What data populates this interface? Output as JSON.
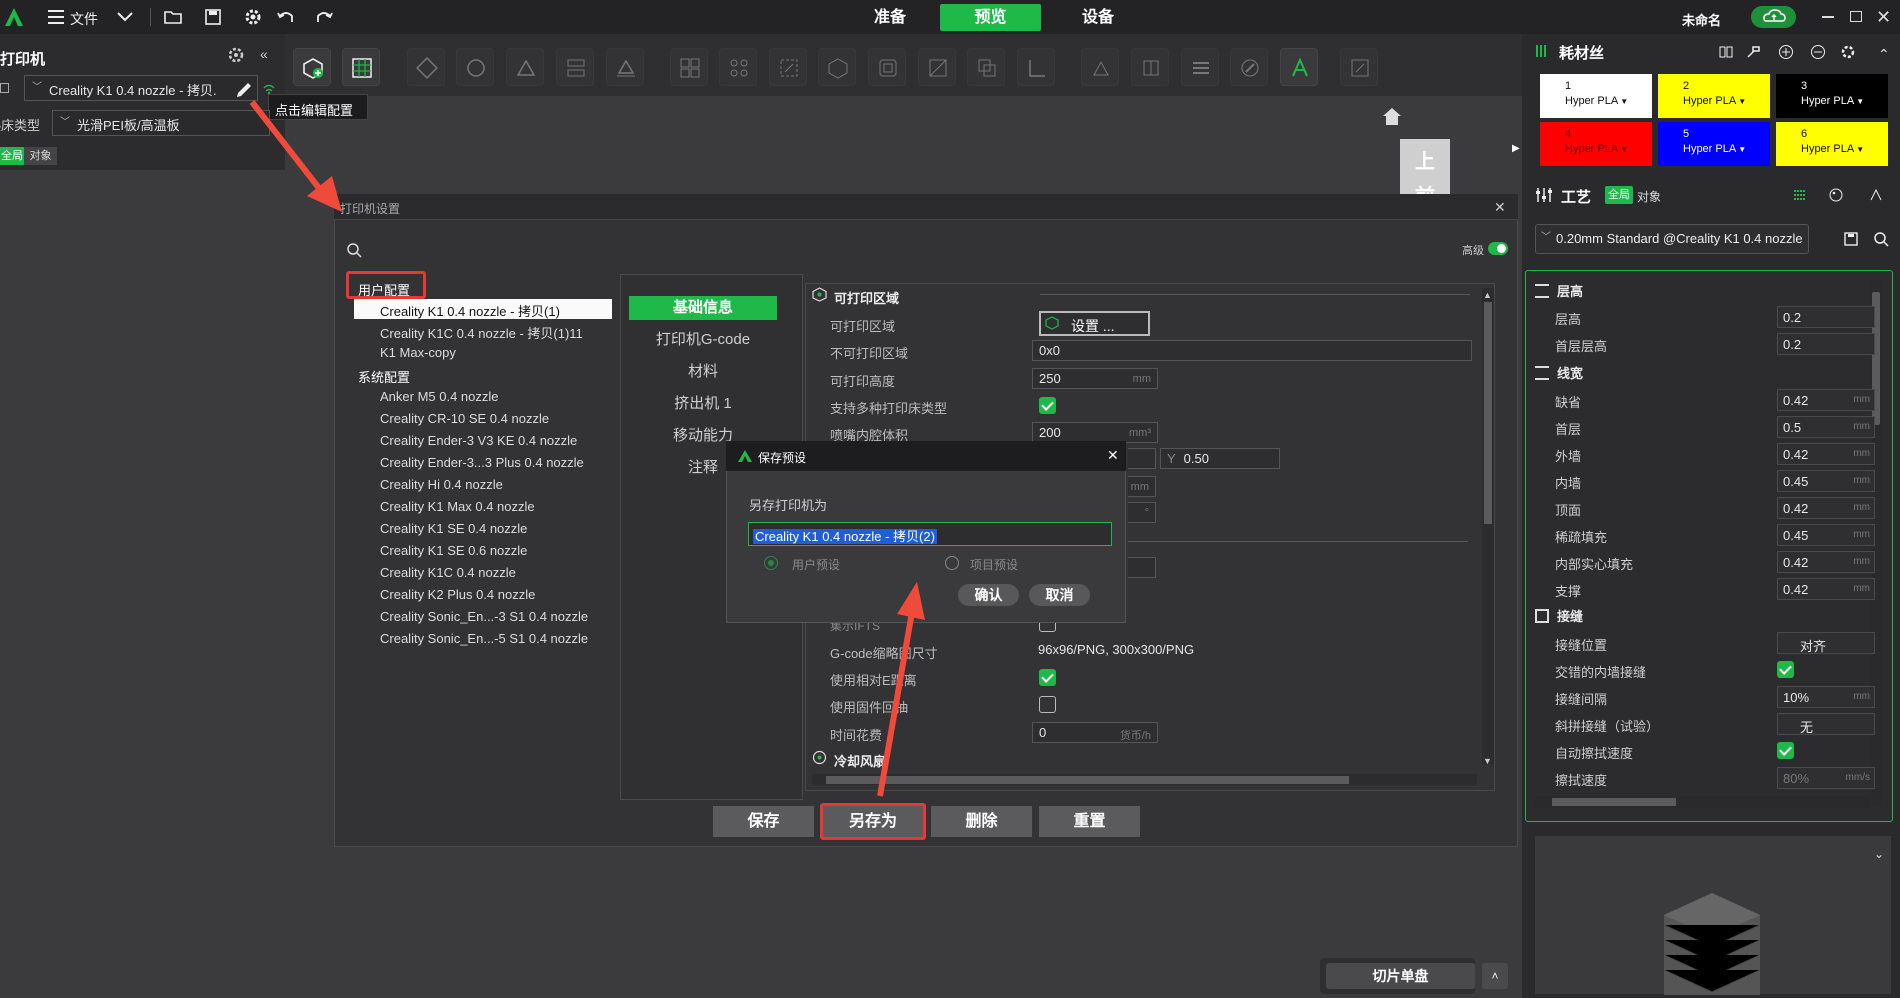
{
  "topbar": {
    "file_label": "文件",
    "tabs": [
      "准备",
      "预览",
      "设备"
    ],
    "active_tab": "预览",
    "project_name": "未命名",
    "accent": "#1fb94a"
  },
  "left": {
    "title": "打印机",
    "printer_name": "Creality K1 0.4 nozzle - 拷贝.",
    "bed_label": "热床类型",
    "bed_value": "光滑PEI板/高温板",
    "scope_global": "全局",
    "scope_object": "对象",
    "tooltip": "点击编辑配置"
  },
  "canvas": {
    "view_top": "上",
    "view_front": "前",
    "slice_button": "切片单盘"
  },
  "right": {
    "filament_title": "耗材丝",
    "filaments": [
      {
        "num": "1",
        "type": "Hyper PLA",
        "color": "#ffffff",
        "text": "#111111"
      },
      {
        "num": "2",
        "type": "Hyper PLA",
        "color": "#ffff00",
        "text": "#111111"
      },
      {
        "num": "3",
        "type": "Hyper PLA",
        "color": "#000000",
        "text": "#ffffff"
      },
      {
        "num": "4",
        "type": "Hyper PLA",
        "color": "#ff0000",
        "text": "#7a0000"
      },
      {
        "num": "5",
        "type": "Hyper PLA",
        "color": "#0000ff",
        "text": "#ffffff"
      },
      {
        "num": "6",
        "type": "Hyper PLA",
        "color": "#ffff00",
        "text": "#111111"
      }
    ],
    "process_title": "工艺",
    "process_global": "全局",
    "process_object": "对象",
    "process_preset": "0.20mm Standard @Creality K1 0.4 nozzle",
    "sec_layer": "层高",
    "layer_rows": [
      {
        "label": "层高",
        "value": "0.2"
      },
      {
        "label": "首层层高",
        "value": "0.2"
      }
    ],
    "sec_width": "线宽",
    "width_rows": [
      {
        "label": "缺省",
        "value": "0.42",
        "unit": "mm"
      },
      {
        "label": "首层",
        "value": "0.5",
        "unit": "mm"
      },
      {
        "label": "外墙",
        "value": "0.42",
        "unit": "mm"
      },
      {
        "label": "内墙",
        "value": "0.45",
        "unit": "mm"
      },
      {
        "label": "顶面",
        "value": "0.42",
        "unit": "mm"
      },
      {
        "label": "稀疏填充",
        "value": "0.45",
        "unit": "mm"
      },
      {
        "label": "内部实心填充",
        "value": "0.42",
        "unit": "mm"
      },
      {
        "label": "支撑",
        "value": "0.42",
        "unit": "mm"
      }
    ],
    "sec_seam": "接缝",
    "seam_position_label": "接缝位置",
    "seam_position_value": "对齐",
    "seam_staggered_label": "交错的内墙接缝",
    "seam_gap_label": "接缝间隔",
    "seam_gap_value": "10%",
    "seam_gap_unit": "mm",
    "scarf_label": "斜拼接缝（试验）",
    "scarf_value": "无",
    "auto_wipe_label": "自动擦拭速度",
    "wipe_speed_label": "擦拭速度",
    "wipe_speed_value": "80%",
    "wipe_speed_unit": "mm/s"
  },
  "dialog": {
    "title": "打印机设置",
    "advanced_label": "高级",
    "user_group": "用户配置",
    "user_presets": [
      "Creality K1 0.4 nozzle - 拷贝(1)",
      "Creality K1C 0.4 nozzle - 拷贝(1)11",
      "K1 Max-copy"
    ],
    "system_group": "系统配置",
    "system_presets": [
      "Anker M5 0.4 nozzle",
      "Creality CR-10 SE 0.4 nozzle",
      "Creality Ender-3 V3 KE 0.4 nozzle",
      "Creality Ender-3...3 Plus 0.4 nozzle",
      "Creality Hi 0.4 nozzle",
      "Creality K1 Max 0.4 nozzle",
      "Creality K1 SE 0.4 nozzle",
      "Creality K1 SE 0.6 nozzle",
      "Creality K1C 0.4 nozzle",
      "Creality K2 Plus 0.4 nozzle",
      "Creality Sonic_En...-3 S1 0.4 nozzle",
      "Creality Sonic_En...-5 S1 0.4 nozzle"
    ],
    "nav": [
      "基础信息",
      "打印机G-code",
      "材料",
      "挤出机 1",
      "移动能力",
      "注释"
    ],
    "section_printable": "可打印区域",
    "printable_area_label": "可打印区域",
    "printable_area_button": "设置 ...",
    "unprintable_label": "不可打印区域",
    "unprintable_value": "0x0",
    "height_label": "可打印高度",
    "height_value": "250",
    "height_unit": "mm",
    "multi_bed_label": "支持多种打印床类型",
    "nozzle_volume_label": "喷嘴内腔体积",
    "nozzle_volume_value": "200",
    "nozzle_volume_unit": "mm³",
    "y_label": "Y",
    "y_value": "0.50",
    "partial_unit_mm": "mm",
    "partial_unit_deg": "°",
    "partial_label_row": "集示IFTS",
    "thumb_label": "G-code缩略图尺寸",
    "thumb_value": "96x96/PNG, 300x300/PNG",
    "rel_e_label": "使用相对E距离",
    "fw_retract_label": "使用固件回抽",
    "time_cost_label": "时间花费",
    "time_cost_value": "0",
    "time_cost_unit": "货币/h",
    "section_cooling": "冷却风扇",
    "buttons": [
      "保存",
      "另存为",
      "删除",
      "重置"
    ]
  },
  "save_dialog": {
    "title": "保存预设",
    "prompt": "另存打印机为",
    "input_value": "Creality K1 0.4 nozzle - 拷贝(2)",
    "option_user": "用户预设",
    "option_project": "项目预设",
    "confirm": "确认",
    "cancel": "取消"
  }
}
